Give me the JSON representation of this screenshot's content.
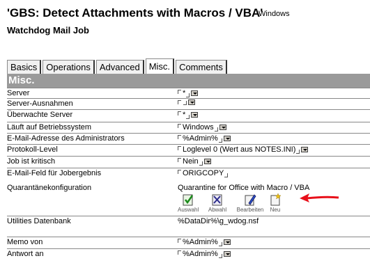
{
  "header": {
    "title": "'GBS: Detect Attachments with Macros / VBA'",
    "platform": "Windows",
    "subtitle": "Watchdog Mail Job"
  },
  "tabs": [
    "Basics",
    "Operations",
    "Advanced",
    "Misc.",
    "Comments"
  ],
  "active_tab": "Misc.",
  "section_title": "Misc.",
  "fields": {
    "server": {
      "label": "Server",
      "value": "*"
    },
    "server_exceptions": {
      "label": "Server-Ausnahmen",
      "value": ""
    },
    "monitored_servers": {
      "label": "Überwachte Server",
      "value": "*"
    },
    "os": {
      "label": "Läuft auf Betriebssystem",
      "value": "Windows"
    },
    "admin_email": {
      "label": "E-Mail-Adresse des Administrators",
      "value": "%Admin%"
    },
    "log_level": {
      "label": "Protokoll-Level",
      "value": "Loglevel 0 (Wert aus NOTES.INI)"
    },
    "critical": {
      "label": "Job ist kritisch",
      "value": "Nein"
    },
    "result_field": {
      "label": "E-Mail-Feld für Jobergebnis",
      "value": "ORIGCOPY"
    },
    "quarantine": {
      "label": "Quarantänekonfiguration",
      "value": "Quarantine for Office with Macro / VBA"
    },
    "utilities_db": {
      "label": "Utilities Datenbank",
      "value": "%DataDir%\\g_wdog.nsf"
    },
    "memo_from": {
      "label": "Memo von",
      "value": "%Admin%"
    },
    "reply_to": {
      "label": "Antwort an",
      "value": "%Admin%"
    }
  },
  "quarantine_buttons": {
    "select": "Auswahl",
    "deselect": "Abwahl",
    "edit": "Bearbeiten",
    "new": "Neu"
  },
  "colors": {
    "section_bar": "#9a9a9a",
    "arrow": "#e8101a"
  }
}
